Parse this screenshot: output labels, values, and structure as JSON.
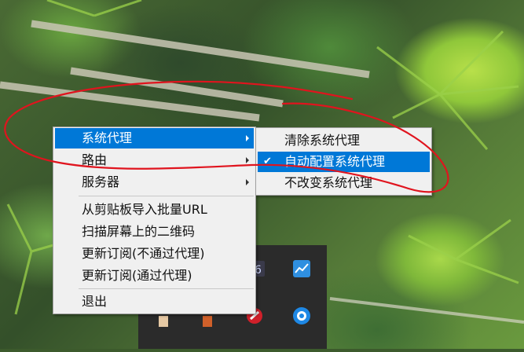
{
  "main_menu": {
    "items": [
      {
        "label": "系统代理",
        "has_submenu": true,
        "highlighted": true
      },
      {
        "label": "路由",
        "has_submenu": true
      },
      {
        "label": "服务器",
        "has_submenu": true
      },
      {
        "label": "从剪贴板导入批量URL"
      },
      {
        "label": "扫描屏幕上的二维码"
      },
      {
        "label": "更新订阅(不通过代理)"
      },
      {
        "label": "更新订阅(通过代理)"
      },
      {
        "label": "退出"
      }
    ]
  },
  "submenu": {
    "items": [
      {
        "label": "清除系统代理"
      },
      {
        "label": "自动配置系统代理",
        "checked": true,
        "highlighted": true
      },
      {
        "label": "不改变系统代理"
      }
    ]
  },
  "tray_icons": [
    "app-tray-icon",
    "chart-tray-icon",
    "notify-tray-icon",
    "cloud-tray-icon"
  ],
  "colors": {
    "menu_background": "#f0f0f0",
    "highlight": "#0078d7",
    "annotation": "#e0141e",
    "tray": "#2b2b2b"
  }
}
